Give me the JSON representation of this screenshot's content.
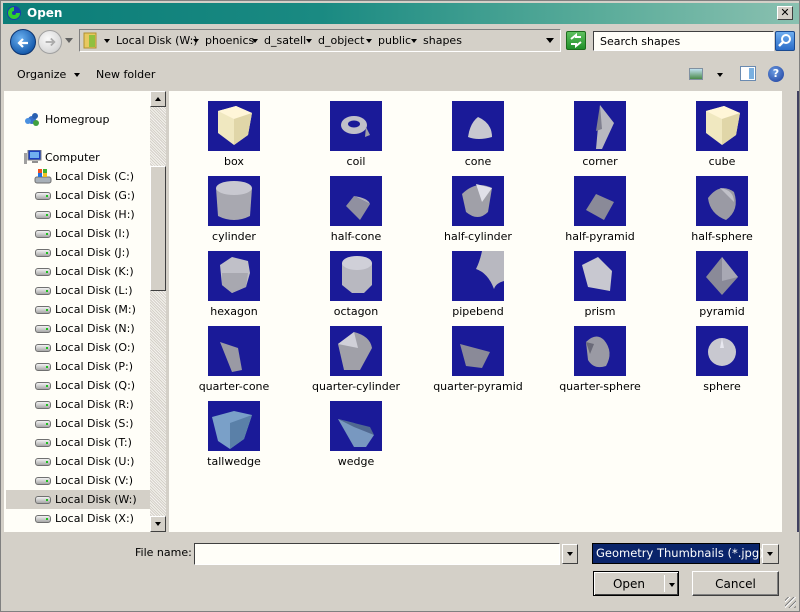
{
  "window": {
    "title": "Open",
    "close_label": "✕"
  },
  "navbar": {
    "breadcrumbs": [
      "Local Disk (W:)",
      "phoenics",
      "d_satell",
      "d_object",
      "public",
      "shapes"
    ],
    "search_placeholder": "Search shapes"
  },
  "toolbar": {
    "organize_label": "Organize",
    "new_folder_label": "New folder",
    "help_label": "?"
  },
  "sidebar": {
    "homegroup": "Homegroup",
    "computer": "Computer",
    "drives": [
      "Local Disk (C:)",
      "Local Disk (G:)",
      "Local Disk (H:)",
      "Local Disk (I:)",
      "Local Disk (J:)",
      "Local Disk (K:)",
      "Local Disk (L:)",
      "Local Disk (M:)",
      "Local Disk (N:)",
      "Local Disk (O:)",
      "Local Disk (P:)",
      "Local Disk (Q:)",
      "Local Disk (R:)",
      "Local Disk (S:)",
      "Local Disk (T:)",
      "Local Disk (U:)",
      "Local Disk (V:)",
      "Local Disk (W:)",
      "Local Disk (X:)"
    ],
    "selected_drive": "Local Disk (W:)"
  },
  "files": [
    {
      "name": "box",
      "shape": "box"
    },
    {
      "name": "coil",
      "shape": "coil"
    },
    {
      "name": "cone",
      "shape": "cone"
    },
    {
      "name": "corner",
      "shape": "corner"
    },
    {
      "name": "cube",
      "shape": "box"
    },
    {
      "name": "cylinder",
      "shape": "cylinder"
    },
    {
      "name": "half-cone",
      "shape": "half-cone"
    },
    {
      "name": "half-cylinder",
      "shape": "half-cylinder"
    },
    {
      "name": "half-pyramid",
      "shape": "half-pyramid"
    },
    {
      "name": "half-sphere",
      "shape": "half-sphere"
    },
    {
      "name": "hexagon",
      "shape": "hexagon"
    },
    {
      "name": "octagon",
      "shape": "octagon"
    },
    {
      "name": "pipebend",
      "shape": "pipebend"
    },
    {
      "name": "prism",
      "shape": "prism"
    },
    {
      "name": "pyramid",
      "shape": "pyramid"
    },
    {
      "name": "quarter-cone",
      "shape": "quarter-cone"
    },
    {
      "name": "quarter-cylinder",
      "shape": "quarter-cylinder"
    },
    {
      "name": "quarter-pyramid",
      "shape": "quarter-pyramid"
    },
    {
      "name": "quarter-sphere",
      "shape": "quarter-sphere"
    },
    {
      "name": "sphere",
      "shape": "sphere"
    },
    {
      "name": "tallwedge",
      "shape": "tallwedge"
    },
    {
      "name": "wedge",
      "shape": "wedge"
    }
  ],
  "footer": {
    "file_name_label": "File name:",
    "file_name_value": "",
    "filter_value": "Geometry Thumbnails (*.jpg)",
    "open_label": "Open",
    "cancel_label": "Cancel"
  },
  "colors": {
    "thumb_background": "#1a1a98",
    "selection": "#0a246a"
  }
}
